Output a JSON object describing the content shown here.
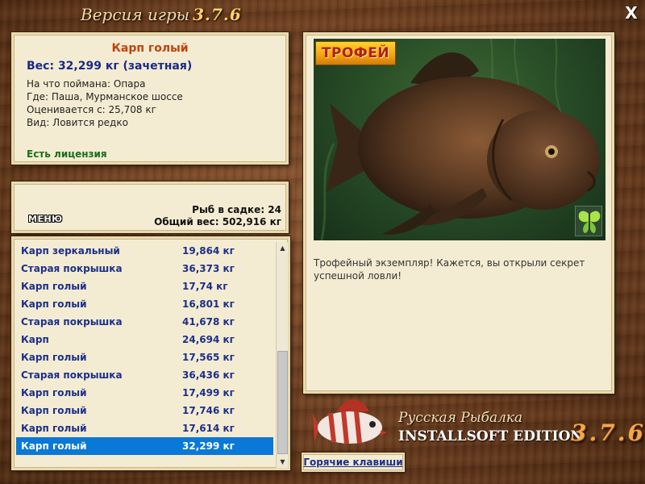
{
  "header": {
    "title": "Версия игры",
    "version": "3.7.6"
  },
  "info": {
    "name": "Карп голый",
    "weight": "Вес: 32,299 кг (зачетная)",
    "bait": "На что поймана: Опара",
    "location": "Где: Паша, Мурманское шоссе",
    "valued_from": "Оценивается с: 25,708 кг",
    "rarity": "Вид: Ловится редко",
    "license": "Есть лицензия"
  },
  "stats": {
    "menu_label": "МЕНЮ",
    "fish_in_cage": "Рыб в садке: 24",
    "total_weight": "Общий вес: 502,916 кг"
  },
  "catch_list": [
    {
      "name": "Карп зеркальный",
      "weight": "19,864 кг"
    },
    {
      "name": "Старая покрышка",
      "weight": "36,373 кг"
    },
    {
      "name": "Карп голый",
      "weight": "17,74 кг"
    },
    {
      "name": "Карп голый",
      "weight": "16,801 кг"
    },
    {
      "name": "Старая покрышка",
      "weight": "41,678 кг"
    },
    {
      "name": "Карп",
      "weight": "24,694 кг"
    },
    {
      "name": "Карп голый",
      "weight": "17,565 кг"
    },
    {
      "name": "Старая покрышка",
      "weight": "36,436 кг"
    },
    {
      "name": "Карп голый",
      "weight": "17,499 кг"
    },
    {
      "name": "Карп голый",
      "weight": "17,746 кг"
    },
    {
      "name": "Карп голый",
      "weight": "17,614 кг"
    },
    {
      "name": "Карп голый",
      "weight": "32,299 кг"
    }
  ],
  "selected_index": 11,
  "detail": {
    "trophy_badge": "ТРОФЕЙ",
    "description": "Трофейный экземпляр! Кажется, вы открыли секрет успешной ловли!"
  },
  "brand": {
    "line1": "Русская Рыбалка",
    "line2": "INSTALLSOFT EDITION",
    "version": "3.7.6"
  },
  "hotkeys_label": "Горячие клавиши",
  "close_label": "X",
  "colors": {
    "accent_orange": "#c2410c",
    "link_blue": "#1c2f8a",
    "selection": "#0a78d7",
    "license_green": "#1b6d1b"
  },
  "icons": [
    "close-icon",
    "butterfly-icon",
    "scroll-up-icon",
    "scroll-down-icon"
  ]
}
